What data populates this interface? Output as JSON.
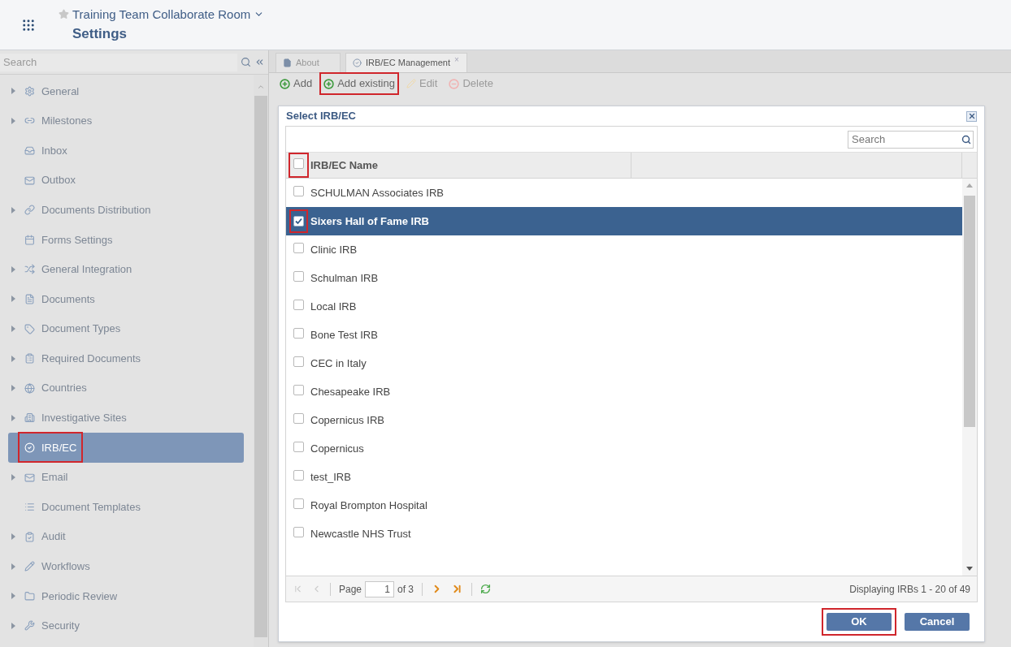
{
  "header": {
    "room": "Training Team Collaborate Room",
    "page": "Settings"
  },
  "sidebar": {
    "search": {
      "placeholder": "Search"
    },
    "items": [
      {
        "label": "General",
        "expandable": true,
        "selected": false,
        "highlighted": false
      },
      {
        "label": "Milestones",
        "expandable": true,
        "selected": false,
        "highlighted": false
      },
      {
        "label": "Inbox",
        "expandable": false,
        "selected": false,
        "highlighted": false
      },
      {
        "label": "Outbox",
        "expandable": false,
        "selected": false,
        "highlighted": false
      },
      {
        "label": "Documents Distribution",
        "expandable": true,
        "selected": false,
        "highlighted": false
      },
      {
        "label": "Forms Settings",
        "expandable": false,
        "selected": false,
        "highlighted": false
      },
      {
        "label": "General Integration",
        "expandable": true,
        "selected": false,
        "highlighted": false
      },
      {
        "label": "Documents",
        "expandable": true,
        "selected": false,
        "highlighted": false
      },
      {
        "label": "Document Types",
        "expandable": true,
        "selected": false,
        "highlighted": false
      },
      {
        "label": "Required Documents",
        "expandable": true,
        "selected": false,
        "highlighted": false
      },
      {
        "label": "Countries",
        "expandable": true,
        "selected": false,
        "highlighted": false
      },
      {
        "label": "Investigative Sites",
        "expandable": true,
        "selected": false,
        "highlighted": false
      },
      {
        "label": "IRB/EC",
        "expandable": false,
        "selected": true,
        "highlighted": true
      },
      {
        "label": "Email",
        "expandable": true,
        "selected": false,
        "highlighted": false
      },
      {
        "label": "Document Templates",
        "expandable": false,
        "selected": false,
        "highlighted": false
      },
      {
        "label": "Audit",
        "expandable": true,
        "selected": false,
        "highlighted": false
      },
      {
        "label": "Workflows",
        "expandable": true,
        "selected": false,
        "highlighted": false
      },
      {
        "label": "Periodic Review",
        "expandable": true,
        "selected": false,
        "highlighted": false
      },
      {
        "label": "Security",
        "expandable": true,
        "selected": false,
        "highlighted": false
      }
    ]
  },
  "tabs": [
    {
      "label": "About",
      "selected": false,
      "closable": false
    },
    {
      "label": "IRB/EC Management",
      "selected": true,
      "closable": true
    }
  ],
  "tab_close": "×",
  "toolbar": [
    {
      "label": "Add",
      "disabled": false,
      "highlighted": false,
      "kind": "add"
    },
    {
      "label": "Add existing",
      "disabled": false,
      "highlighted": true,
      "kind": "add"
    },
    {
      "label": "Edit",
      "disabled": true,
      "highlighted": false,
      "kind": "edit"
    },
    {
      "label": "Delete",
      "disabled": true,
      "highlighted": false,
      "kind": "delete"
    }
  ],
  "dialog": {
    "title": "Select IRB/EC",
    "search": {
      "placeholder": "Search"
    },
    "header": {
      "label": "IRB/EC Name",
      "checked": false,
      "highlighted": true
    },
    "rows": [
      {
        "name": "SCHULMAN Associates IRB",
        "checked": false,
        "selected": false,
        "highlighted": false
      },
      {
        "name": "Sixers Hall of Fame IRB",
        "checked": true,
        "selected": true,
        "highlighted": true
      },
      {
        "name": "Clinic IRB",
        "checked": false,
        "selected": false,
        "highlighted": false
      },
      {
        "name": "Schulman IRB",
        "checked": false,
        "selected": false,
        "highlighted": false
      },
      {
        "name": "Local IRB",
        "checked": false,
        "selected": false,
        "highlighted": false
      },
      {
        "name": "Bone Test IRB",
        "checked": false,
        "selected": false,
        "highlighted": false
      },
      {
        "name": "CEC in Italy",
        "checked": false,
        "selected": false,
        "highlighted": false
      },
      {
        "name": "Chesapeake IRB",
        "checked": false,
        "selected": false,
        "highlighted": false
      },
      {
        "name": "Copernicus IRB",
        "checked": false,
        "selected": false,
        "highlighted": false
      },
      {
        "name": "Copernicus",
        "checked": false,
        "selected": false,
        "highlighted": false
      },
      {
        "name": "test_IRB",
        "checked": false,
        "selected": false,
        "highlighted": false
      },
      {
        "name": "Royal Brompton Hospital",
        "checked": false,
        "selected": false,
        "highlighted": false
      },
      {
        "name": "Newcastle NHS Trust",
        "checked": false,
        "selected": false,
        "highlighted": false
      }
    ],
    "pager": {
      "page_label": "Page",
      "page": "1",
      "of": "of 3",
      "summary": "Displaying IRBs 1 - 20 of 49"
    },
    "buttons": [
      {
        "label": "OK",
        "highlighted": true
      },
      {
        "label": "Cancel",
        "highlighted": false
      }
    ]
  }
}
